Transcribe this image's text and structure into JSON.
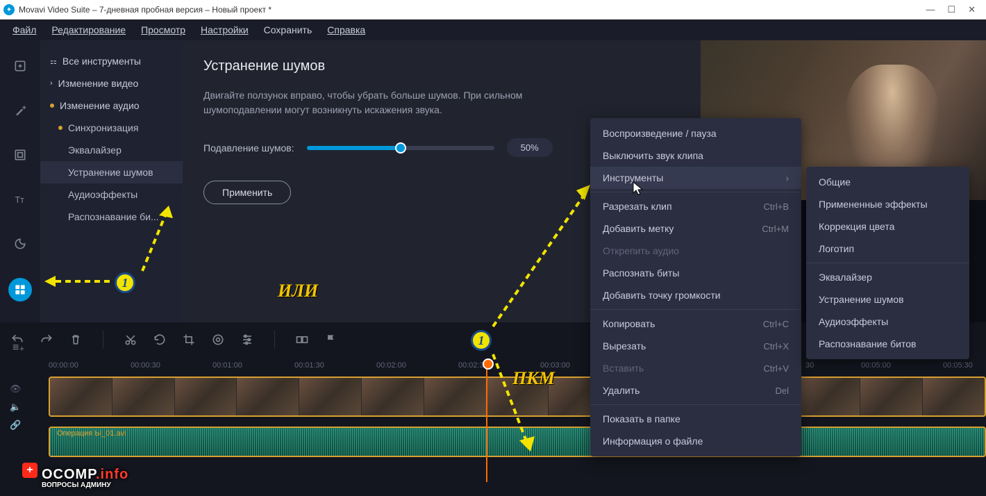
{
  "title": "Movavi Video Suite – 7-дневная пробная версия – Новый проект *",
  "menubar": [
    "Файл",
    "Редактирование",
    "Просмотр",
    "Настройки",
    "Сохранить",
    "Справка"
  ],
  "tool_list": {
    "all": "Все инструменты",
    "video": "Изменение видео",
    "audio": "Изменение аудио",
    "sync": "Синхронизация",
    "eq": "Эквалайзер",
    "noise": "Устранение шумов",
    "fx": "Аудиоэффекты",
    "beat": "Распознавание би..."
  },
  "panel": {
    "title": "Устранение шумов",
    "desc": "Двигайте ползунок вправо, чтобы убрать больше шумов. При сильном шумоподавлении могут возникнуть искажения звука.",
    "slider_label": "Подавление шумов:",
    "value": "50%",
    "apply": "Применить"
  },
  "ruler": [
    "00:00:00",
    "00:00:30",
    "00:01:00",
    "00:01:30",
    "00:02:00",
    "00:02:30",
    "00:03:00",
    "",
    "30",
    "00:05:00",
    "00:05:30"
  ],
  "audio_clip_label": "Операция Ы_01.avi",
  "ctx1": {
    "play": "Воспроизведение / пауза",
    "mute": "Выключить звук клипа",
    "tools": "Инструменты",
    "split": "Разрезать клип",
    "split_k": "Ctrl+B",
    "marker": "Добавить метку",
    "marker_k": "Ctrl+M",
    "detach": "Открепить аудио",
    "beats": "Распознать биты",
    "vol": "Добавить точку громкости",
    "copy": "Копировать",
    "copy_k": "Ctrl+C",
    "cut": "Вырезать",
    "cut_k": "Ctrl+X",
    "paste": "Вставить",
    "paste_k": "Ctrl+V",
    "del": "Удалить",
    "del_k": "Del",
    "folder": "Показать в папке",
    "info": "Информация о файле"
  },
  "ctx2": {
    "common": "Общие",
    "applied": "Примененные эффекты",
    "color": "Коррекция цвета",
    "logo": "Логотип",
    "eq": "Эквалайзер",
    "noise": "Устранение шумов",
    "afx": "Аудиоэффекты",
    "beat": "Распознавание битов"
  },
  "anno": {
    "or": "ИЛИ",
    "rmb": "ПКМ"
  },
  "watermark": {
    "main": "OCOMP",
    "suffix": ".info",
    "sub": "ВОПРОСЫ АДМИНУ"
  }
}
